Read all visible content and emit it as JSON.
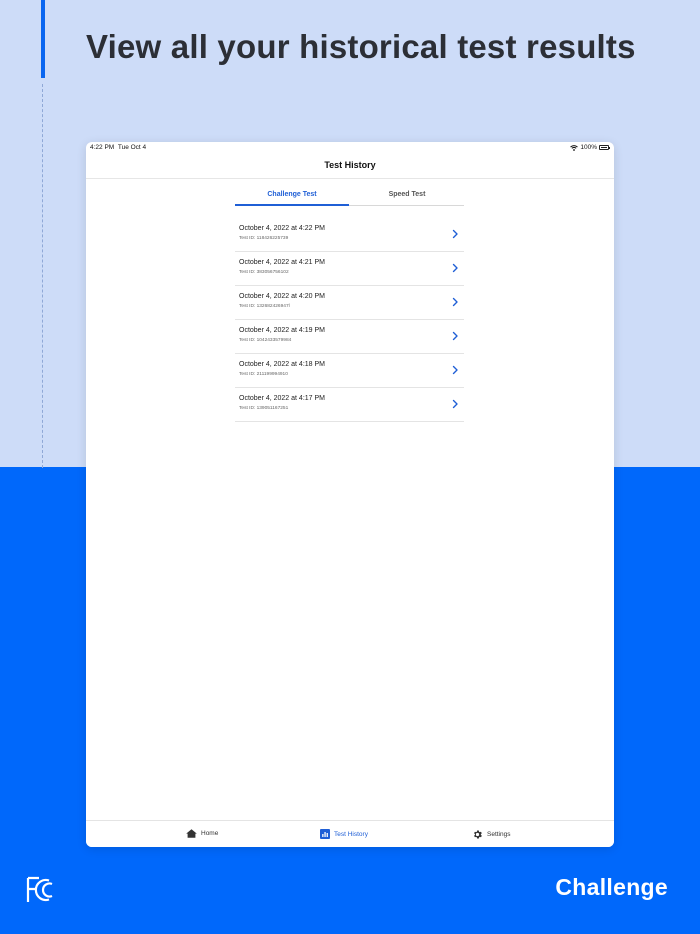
{
  "headline": "View all your historical test results",
  "status_bar": {
    "time": "4:22 PM",
    "date": "Tue Oct 4",
    "battery": "100%"
  },
  "nav": {
    "title": "Test History"
  },
  "segments": [
    {
      "label": "Challenge Test",
      "selected": true
    },
    {
      "label": "Speed Test",
      "selected": false
    }
  ],
  "history": [
    {
      "date": "October 4, 2022 at 4:22 PM",
      "test_id": "Test ID: 118426225739"
    },
    {
      "date": "October 4, 2022 at 4:21 PM",
      "test_id": "Test ID: 383056756102"
    },
    {
      "date": "October 4, 2022 at 4:20 PM",
      "test_id": "Test ID: 132682426947l"
    },
    {
      "date": "October 4, 2022 at 4:19 PM",
      "test_id": "Test ID: 1042433579984"
    },
    {
      "date": "October 4, 2022 at 4:18 PM",
      "test_id": "Test ID: 211199994910"
    },
    {
      "date": "October 4, 2022 at 4:17 PM",
      "test_id": "Test ID: 139051167251"
    }
  ],
  "tabbar": {
    "home": "Home",
    "history": "Test History",
    "settings": "Settings"
  },
  "brand": "Challenge",
  "icons": {
    "chevron": "chevron-right-icon",
    "home": "house-icon",
    "history": "bar-chart-icon",
    "settings": "gear-icon",
    "fcc": "fcc-logo"
  },
  "colors": {
    "accent": "#1f5fd6",
    "background_top": "#cddcf8",
    "background_bottom": "#0068fb"
  }
}
